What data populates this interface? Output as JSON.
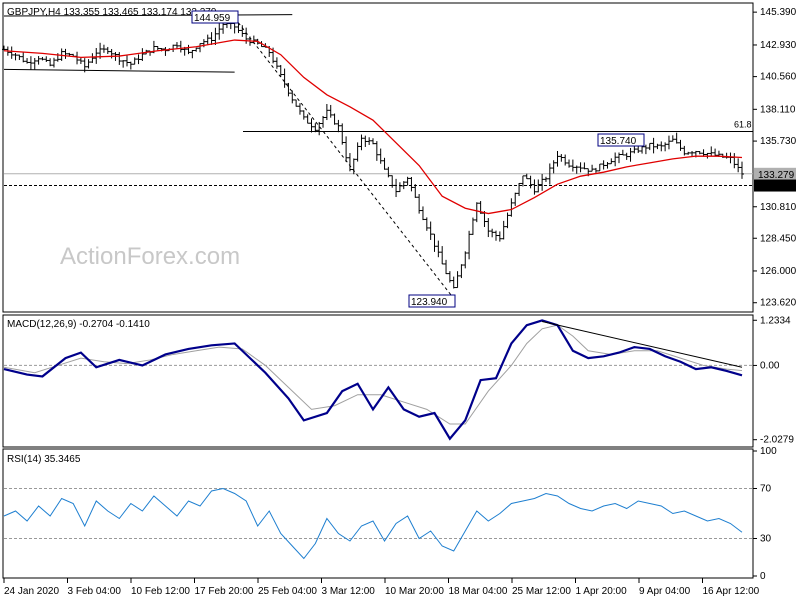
{
  "chart_data": [
    {
      "type": "candlestick",
      "header": "GBPJPY,H4  133.355 133.465 133.174 133.279",
      "watermark": "ActionForex.com",
      "ylim": [
        123.0,
        146.0
      ],
      "y_ticks": [
        "145.390",
        "142.930",
        "140.560",
        "138.110",
        "135.730",
        "133.279",
        "132.400",
        "130.810",
        "128.450",
        "126.000",
        "123.620"
      ],
      "x_ticks": [
        "24 Jan 2020",
        "3 Feb 04:00",
        "10 Feb 12:00",
        "17 Feb 20:00",
        "25 Feb 04:00",
        "3 Mar 12:00",
        "10 Mar 20:00",
        "18 Mar 04:00",
        "25 Mar 12:00",
        "1 Apr 20:00",
        "9 Apr 04:00",
        "16 Apr 12:00"
      ],
      "last_price": 133.279,
      "support_level": 132.4,
      "fib_label": "61.8",
      "fib_level": 136.45,
      "annotations": [
        {
          "text": "144.959",
          "value": 144.959
        },
        {
          "text": "123.940",
          "value": 123.94
        },
        {
          "text": "135.740",
          "value": 135.74
        }
      ],
      "close_path": [
        [
          0,
          142.6
        ],
        [
          3,
          142.2
        ],
        [
          6,
          141.6
        ],
        [
          9,
          142.0
        ],
        [
          12,
          141.4
        ],
        [
          15,
          142.3
        ],
        [
          18,
          142.1
        ],
        [
          21,
          141.3
        ],
        [
          24,
          142.4
        ],
        [
          27,
          142.6
        ],
        [
          30,
          141.9
        ],
        [
          33,
          141.5
        ],
        [
          36,
          142.2
        ],
        [
          39,
          142.7
        ],
        [
          42,
          142.6
        ],
        [
          45,
          143.0
        ],
        [
          48,
          142.3
        ],
        [
          51,
          143.1
        ],
        [
          54,
          143.4
        ],
        [
          57,
          144.5
        ],
        [
          60,
          144.3
        ],
        [
          63,
          143.4
        ],
        [
          66,
          143.0
        ],
        [
          69,
          142.4
        ],
        [
          72,
          140.6
        ],
        [
          75,
          138.9
        ],
        [
          78,
          137.4
        ],
        [
          81,
          136.7
        ],
        [
          84,
          137.9
        ],
        [
          87,
          136.8
        ],
        [
          90,
          133.5
        ],
        [
          93,
          136.0
        ],
        [
          96,
          135.5
        ],
        [
          99,
          133.5
        ],
        [
          102,
          132.0
        ],
        [
          105,
          133.0
        ],
        [
          108,
          130.7
        ],
        [
          111,
          128.7
        ],
        [
          114,
          126.5
        ],
        [
          117,
          124.6
        ],
        [
          120,
          127.5
        ],
        [
          123,
          131.2
        ],
        [
          126,
          129.0
        ],
        [
          129,
          128.5
        ],
        [
          132,
          131.0
        ],
        [
          135,
          133.2
        ],
        [
          138,
          132.1
        ],
        [
          141,
          133.0
        ],
        [
          144,
          134.7
        ],
        [
          147,
          134.0
        ],
        [
          150,
          133.8
        ],
        [
          153,
          133.5
        ],
        [
          156,
          134.0
        ],
        [
          159,
          134.5
        ],
        [
          162,
          134.7
        ],
        [
          165,
          135.1
        ],
        [
          168,
          135.4
        ],
        [
          171,
          135.3
        ],
        [
          174,
          135.8
        ],
        [
          177,
          134.9
        ],
        [
          180,
          135.0
        ],
        [
          183,
          134.8
        ],
        [
          186,
          134.6
        ],
        [
          189,
          134.4
        ],
        [
          192,
          133.3
        ]
      ],
      "ma_path": [
        [
          0,
          142.5
        ],
        [
          10,
          142.3
        ],
        [
          20,
          142.0
        ],
        [
          30,
          142.1
        ],
        [
          40,
          142.5
        ],
        [
          50,
          142.8
        ],
        [
          60,
          143.3
        ],
        [
          66,
          143.2
        ],
        [
          72,
          142.2
        ],
        [
          78,
          140.5
        ],
        [
          84,
          139.2
        ],
        [
          90,
          138.3
        ],
        [
          96,
          137.3
        ],
        [
          102,
          135.6
        ],
        [
          108,
          133.9
        ],
        [
          114,
          131.6
        ],
        [
          120,
          130.7
        ],
        [
          126,
          130.3
        ],
        [
          132,
          130.6
        ],
        [
          138,
          131.5
        ],
        [
          144,
          132.5
        ],
        [
          150,
          133.1
        ],
        [
          156,
          133.4
        ],
        [
          162,
          133.8
        ],
        [
          168,
          134.1
        ],
        [
          174,
          134.4
        ],
        [
          180,
          134.6
        ],
        [
          186,
          134.6
        ],
        [
          192,
          134.5
        ]
      ],
      "channel_lines": [
        {
          "from": [
            0,
            145.1
          ],
          "to": [
            75,
            145.2
          ]
        },
        {
          "from": [
            0,
            141.1
          ],
          "to": [
            60,
            140.9
          ]
        }
      ],
      "trend_line": {
        "from": [
          60,
          144.95
        ],
        "to": [
          117,
          123.94
        ]
      }
    },
    {
      "type": "line",
      "header": "MACD(12,26,9) -0.2704 -0.1410",
      "ylim": [
        -2.2,
        1.35
      ],
      "y_ticks": [
        {
          "value": 1.2334,
          "label": "1.2334"
        },
        {
          "value": 0.0,
          "label": "0.00"
        },
        {
          "value": -2.0279,
          "label": "-2.0279"
        }
      ],
      "series": [
        {
          "values": [
            [
              0,
              -0.1
            ],
            [
              6,
              -0.25
            ],
            [
              10,
              -0.3
            ],
            [
              16,
              0.2
            ],
            [
              20,
              0.35
            ],
            [
              24,
              -0.05
            ],
            [
              30,
              0.15
            ],
            [
              36,
              0.0
            ],
            [
              42,
              0.3
            ],
            [
              48,
              0.45
            ],
            [
              54,
              0.55
            ],
            [
              60,
              0.6
            ],
            [
              64,
              0.2
            ],
            [
              68,
              -0.2
            ],
            [
              74,
              -0.9
            ],
            [
              78,
              -1.5
            ],
            [
              84,
              -1.3
            ],
            [
              88,
              -0.7
            ],
            [
              92,
              -0.5
            ],
            [
              96,
              -1.2
            ],
            [
              100,
              -0.6
            ],
            [
              104,
              -1.2
            ],
            [
              108,
              -1.4
            ],
            [
              112,
              -1.3
            ],
            [
              116,
              -2.0
            ],
            [
              120,
              -1.5
            ],
            [
              124,
              -0.4
            ],
            [
              128,
              -0.35
            ],
            [
              132,
              0.6
            ],
            [
              136,
              1.1
            ],
            [
              140,
              1.23
            ],
            [
              144,
              1.1
            ],
            [
              148,
              0.4
            ],
            [
              152,
              0.2
            ],
            [
              156,
              0.25
            ],
            [
              160,
              0.35
            ],
            [
              164,
              0.5
            ],
            [
              168,
              0.45
            ],
            [
              172,
              0.25
            ],
            [
              176,
              0.1
            ],
            [
              180,
              -0.1
            ],
            [
              184,
              -0.05
            ],
            [
              188,
              -0.15
            ],
            [
              192,
              -0.27
            ]
          ]
        },
        {
          "values": [
            [
              0,
              -0.05
            ],
            [
              8,
              -0.2
            ],
            [
              14,
              0.0
            ],
            [
              20,
              0.2
            ],
            [
              26,
              0.1
            ],
            [
              32,
              0.05
            ],
            [
              38,
              0.15
            ],
            [
              44,
              0.3
            ],
            [
              50,
              0.4
            ],
            [
              56,
              0.5
            ],
            [
              62,
              0.45
            ],
            [
              68,
              0.0
            ],
            [
              74,
              -0.6
            ],
            [
              80,
              -1.2
            ],
            [
              86,
              -1.1
            ],
            [
              92,
              -0.8
            ],
            [
              98,
              -0.8
            ],
            [
              104,
              -1.0
            ],
            [
              110,
              -1.2
            ],
            [
              116,
              -1.6
            ],
            [
              120,
              -1.6
            ],
            [
              126,
              -0.7
            ],
            [
              132,
              0.0
            ],
            [
              136,
              0.6
            ],
            [
              140,
              1.0
            ],
            [
              144,
              1.1
            ],
            [
              148,
              0.8
            ],
            [
              152,
              0.4
            ],
            [
              158,
              0.3
            ],
            [
              164,
              0.4
            ],
            [
              170,
              0.4
            ],
            [
              176,
              0.2
            ],
            [
              182,
              0.0
            ],
            [
              188,
              -0.1
            ],
            [
              192,
              -0.14
            ]
          ]
        }
      ],
      "trend_line": {
        "from": [
          140,
          1.2
        ],
        "to": [
          192,
          -0.05
        ]
      }
    },
    {
      "type": "line",
      "header": "RSI(14) 35.3465",
      "ylim": [
        0,
        100
      ],
      "y_ticks": [
        {
          "value": 100,
          "label": "100"
        },
        {
          "value": 70,
          "label": "70"
        },
        {
          "value": 30,
          "label": "30"
        },
        {
          "value": 0,
          "label": "0"
        }
      ],
      "series": [
        {
          "values": [
            [
              0,
              48
            ],
            [
              3,
              52
            ],
            [
              6,
              44
            ],
            [
              9,
              56
            ],
            [
              12,
              48
            ],
            [
              15,
              62
            ],
            [
              18,
              58
            ],
            [
              21,
              40
            ],
            [
              24,
              60
            ],
            [
              27,
              52
            ],
            [
              30,
              46
            ],
            [
              33,
              58
            ],
            [
              36,
              52
            ],
            [
              39,
              64
            ],
            [
              42,
              56
            ],
            [
              45,
              48
            ],
            [
              48,
              60
            ],
            [
              51,
              56
            ],
            [
              54,
              68
            ],
            [
              57,
              70
            ],
            [
              60,
              66
            ],
            [
              63,
              60
            ],
            [
              66,
              40
            ],
            [
              69,
              52
            ],
            [
              72,
              34
            ],
            [
              75,
              24
            ],
            [
              78,
              14
            ],
            [
              81,
              26
            ],
            [
              84,
              46
            ],
            [
              87,
              34
            ],
            [
              90,
              28
            ],
            [
              93,
              40
            ],
            [
              96,
              44
            ],
            [
              99,
              28
            ],
            [
              102,
              42
            ],
            [
              105,
              48
            ],
            [
              108,
              30
            ],
            [
              111,
              36
            ],
            [
              114,
              24
            ],
            [
              117,
              20
            ],
            [
              120,
              36
            ],
            [
              123,
              52
            ],
            [
              126,
              44
            ],
            [
              129,
              50
            ],
            [
              132,
              58
            ],
            [
              135,
              60
            ],
            [
              138,
              62
            ],
            [
              141,
              66
            ],
            [
              144,
              64
            ],
            [
              147,
              58
            ],
            [
              150,
              54
            ],
            [
              153,
              52
            ],
            [
              156,
              56
            ],
            [
              159,
              58
            ],
            [
              162,
              54
            ],
            [
              165,
              60
            ],
            [
              168,
              58
            ],
            [
              171,
              56
            ],
            [
              174,
              50
            ],
            [
              177,
              52
            ],
            [
              180,
              48
            ],
            [
              183,
              44
            ],
            [
              186,
              46
            ],
            [
              189,
              42
            ],
            [
              192,
              35
            ]
          ]
        }
      ],
      "last_value": 35.3465
    }
  ]
}
